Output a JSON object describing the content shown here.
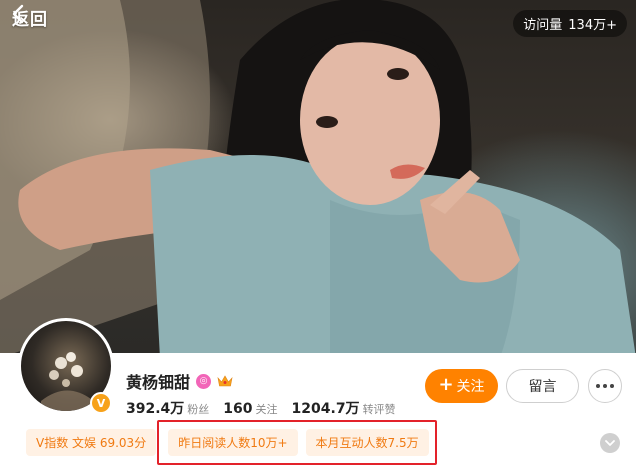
{
  "header": {
    "back_label": "返回",
    "visits_label": "访问量",
    "visits_value": "134万+"
  },
  "profile": {
    "name": "黄杨钿甜",
    "stats": [
      {
        "num": "392.4万",
        "label": "粉丝"
      },
      {
        "num": "160",
        "label": "关注"
      },
      {
        "num": "1204.7万",
        "label": "转评赞"
      }
    ]
  },
  "actions": {
    "follow_label": "关注",
    "message_label": "留言"
  },
  "tags": {
    "vindex": "V指数 文娱 69.03分",
    "reads": "昨日阅读人数10万+",
    "interactions": "本月互动人数7.5万"
  },
  "colors": {
    "accent": "#ff8200",
    "tag_text": "#f07a12",
    "tag_bg": "#fff1e4",
    "highlight": "#e3222a"
  },
  "icons": [
    "chevron-left-icon",
    "vip-icon",
    "crown-icon",
    "verified-badge-icon",
    "plus-icon",
    "more-dots-icon",
    "chevron-down-icon"
  ]
}
